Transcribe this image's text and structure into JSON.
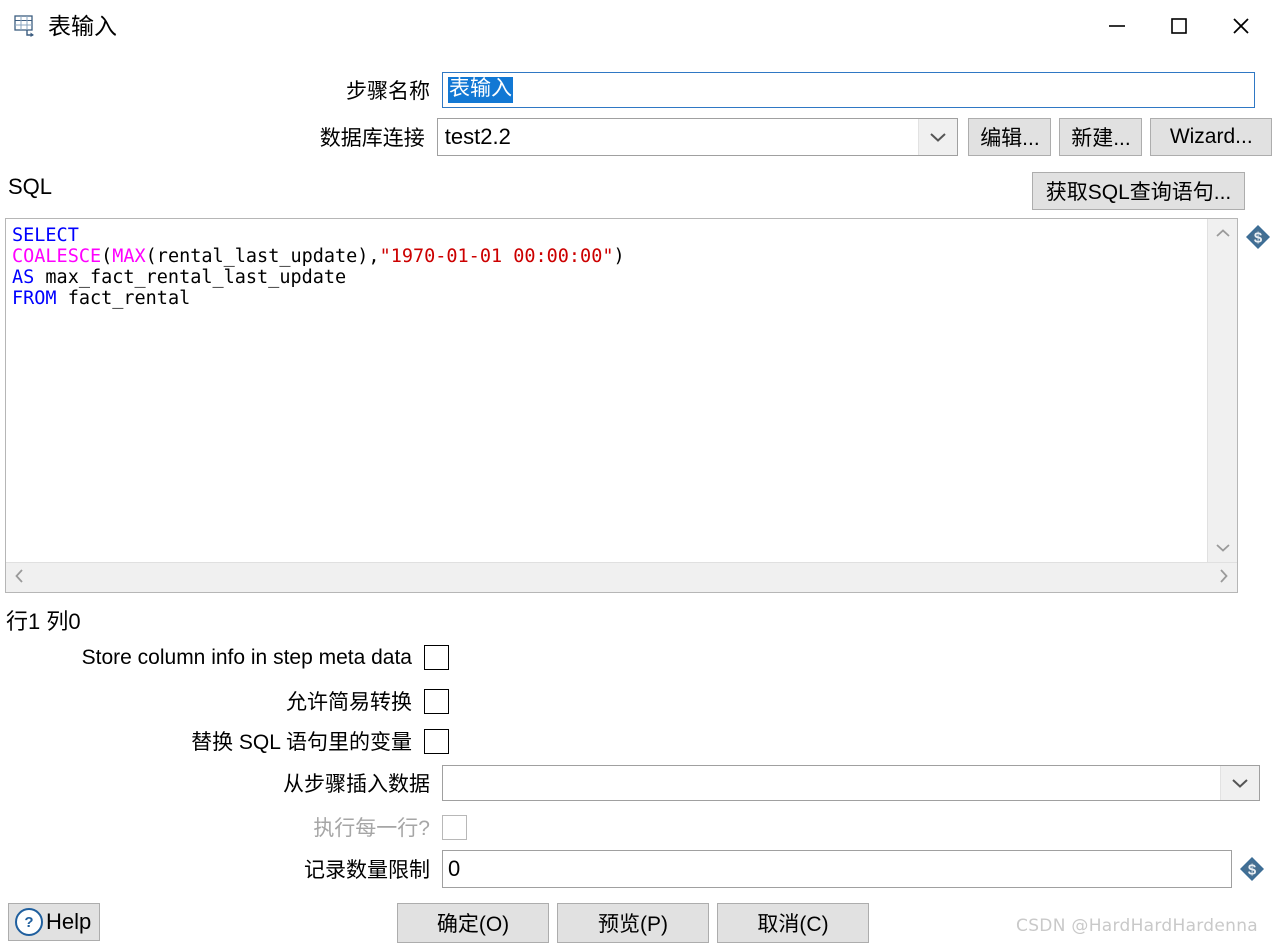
{
  "window": {
    "title": "表输入",
    "icon": "table-input-icon",
    "controls": {
      "minimize": "minimize-icon",
      "maximize": "maximize-icon",
      "close": "close-icon"
    }
  },
  "form": {
    "step_name_label": "步骤名称",
    "step_name_value": "表输入",
    "step_name_selected": true,
    "connection_label": "数据库连接",
    "connection_value": "test2.2",
    "edit_button": "编辑...",
    "new_button": "新建...",
    "wizard_button": "Wizard..."
  },
  "sql": {
    "section_label": "SQL",
    "get_query_button": "获取SQL查询语句...",
    "status": "行1 列0",
    "variable_icon": "variable-dollar-icon",
    "lines": [
      [
        {
          "t": "SELECT",
          "c": "kw"
        }
      ],
      [
        {
          "t": "COALESCE",
          "c": "fn"
        },
        {
          "t": "(",
          "c": ""
        },
        {
          "t": "MAX",
          "c": "fn"
        },
        {
          "t": "(rental_last_update),",
          "c": ""
        },
        {
          "t": "\"1970-01-01 00:00:00\"",
          "c": "str"
        },
        {
          "t": ")",
          "c": ""
        }
      ],
      [
        {
          "t": "AS",
          "c": "kw"
        },
        {
          "t": " max_fact_rental_last_update",
          "c": ""
        }
      ],
      [
        {
          "t": "FROM",
          "c": "kw"
        },
        {
          "t": " fact_rental",
          "c": ""
        }
      ]
    ],
    "plain_text": "SELECT\nCOALESCE(MAX(rental_last_update),\"1970-01-01 00:00:00\")\nAS max_fact_rental_last_update\nFROM fact_rental"
  },
  "options": {
    "store_column_info_label": "Store column info in step meta data",
    "store_column_info_checked": false,
    "lazy_conversion_label": "允许简易转换",
    "lazy_conversion_checked": false,
    "replace_variables_label": "替换 SQL 语句里的变量",
    "replace_variables_checked": false,
    "insert_data_from_step_label": "从步骤插入数据",
    "insert_data_from_step_value": "",
    "execute_each_row_label": "执行每一行?",
    "execute_each_row_checked": false,
    "execute_each_row_disabled": true,
    "limit_label": "记录数量限制",
    "limit_value": "0",
    "limit_variable_icon": "variable-dollar-icon"
  },
  "footer": {
    "help_label": "Help",
    "help_icon": "help-question-icon",
    "ok_button": "确定(O)",
    "preview_button": "预览(P)",
    "cancel_button": "取消(C)"
  },
  "watermark": "CSDN @HardHardHardenna",
  "colors": {
    "selection_blue": "#1278d4",
    "keyword": "#0000ff",
    "function": "#ff00ff",
    "string": "#cc0000",
    "button_face": "#e1e1e1",
    "border": "#a0a0a0"
  }
}
